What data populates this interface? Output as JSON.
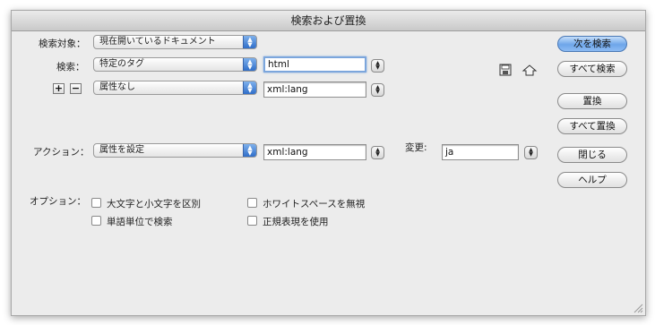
{
  "window": {
    "title": "検索および置換"
  },
  "search_in": {
    "label": "検索対象：",
    "value": "現在開いているドキュメント"
  },
  "search": {
    "label": "検索：",
    "type_value": "特定のタグ",
    "tag_value": "html",
    "attr_mode": "属性なし",
    "attr_value": "xml:lang"
  },
  "action": {
    "label": "アクション：",
    "value": "属性を設定",
    "attr_value": "xml:lang",
    "change_label": "変更:",
    "change_value": "ja"
  },
  "options": {
    "label": "オプション：",
    "items": [
      {
        "label": "大文字と小文字を区別",
        "checked": false
      },
      {
        "label": "単語単位で検索",
        "checked": false
      },
      {
        "label": "ホワイトスペースを無視",
        "checked": false
      },
      {
        "label": "正規表現を使用",
        "checked": false
      }
    ]
  },
  "buttons": {
    "find_next": "次を検索",
    "find_all": "すべて検索",
    "replace": "置換",
    "replace_all": "すべて置換",
    "close": "閉じる",
    "help": "ヘルプ"
  },
  "icons": {
    "plus": "+",
    "minus": "−",
    "save": "save-query-icon",
    "load": "load-query-icon"
  }
}
